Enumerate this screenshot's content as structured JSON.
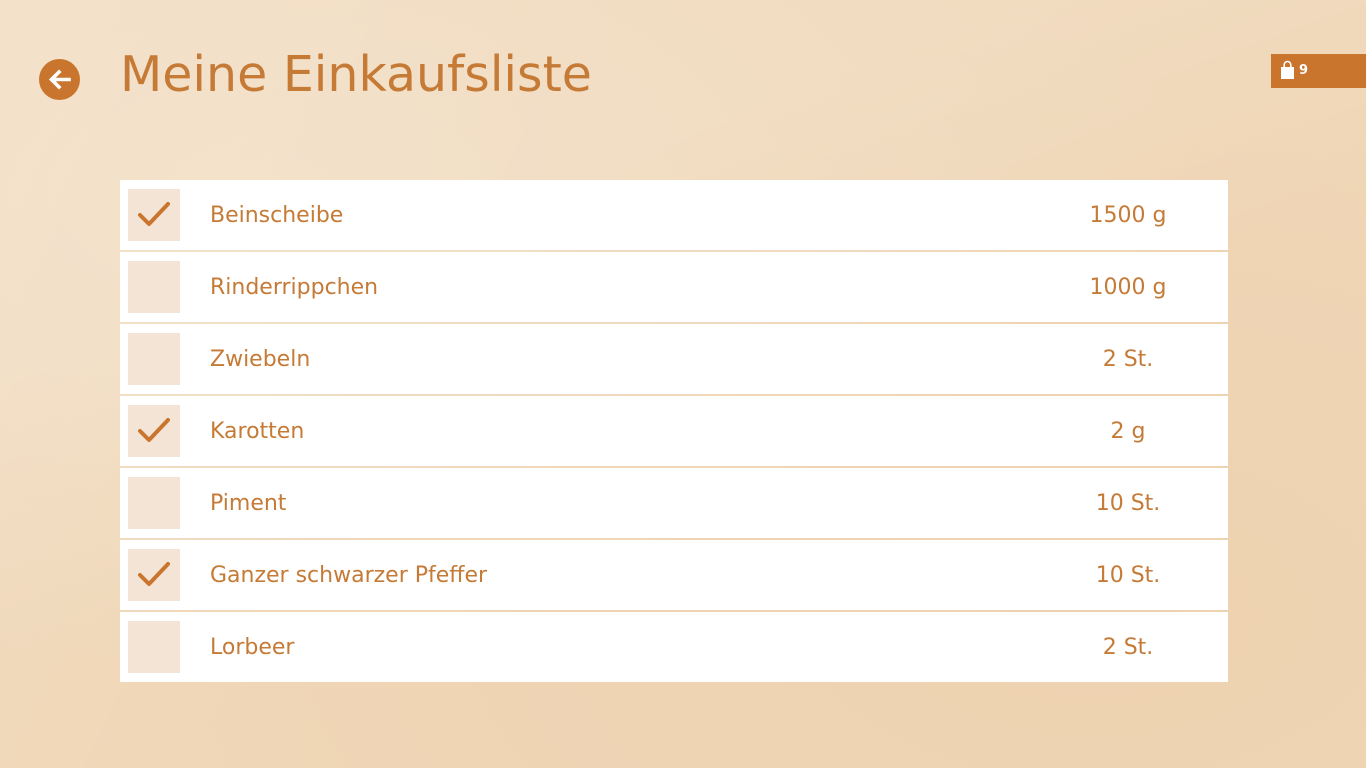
{
  "header": {
    "title": "Meine Einkaufsliste",
    "back_icon": "arrow-left-icon"
  },
  "cart": {
    "icon": "shopping-bag-icon",
    "count": "9"
  },
  "colors": {
    "accent": "#c9752e",
    "text": "#c57a36",
    "checkbox_bg": "#f4e4d6",
    "background": "#efd6b6"
  },
  "items": [
    {
      "name": "Beinscheibe",
      "qty": "1500 g",
      "checked": true
    },
    {
      "name": "Rinderrippchen",
      "qty": "1000 g",
      "checked": false
    },
    {
      "name": "Zwiebeln",
      "qty": "2 St.",
      "checked": false
    },
    {
      "name": "Karotten",
      "qty": "2 g",
      "checked": true
    },
    {
      "name": "Piment",
      "qty": "10 St.",
      "checked": false
    },
    {
      "name": "Ganzer schwarzer Pfeffer",
      "qty": "10 St.",
      "checked": true
    },
    {
      "name": "Lorbeer",
      "qty": "2 St.",
      "checked": false
    }
  ]
}
